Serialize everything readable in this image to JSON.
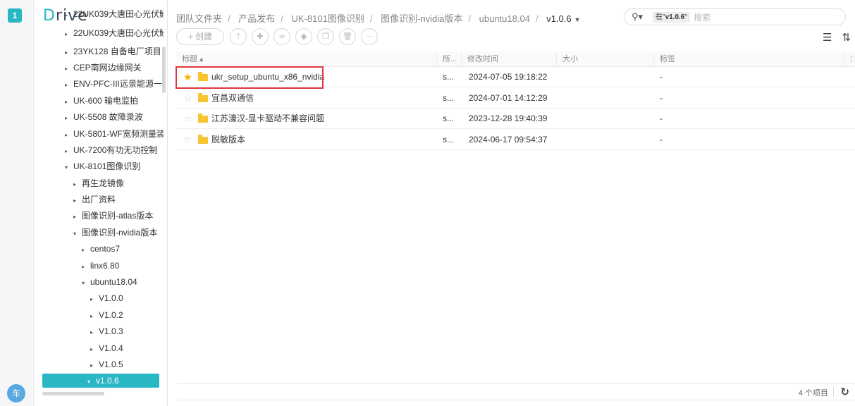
{
  "rail": {
    "workspace_badge": "1",
    "user_avatar": "车"
  },
  "app": {
    "logo_first": "D",
    "logo_rest": "rive"
  },
  "tree": [
    {
      "label": "22UK039大唐田心光伏鳗",
      "arrow": "▸"
    },
    {
      "label": "23YK128 自备电厂项目",
      "arrow": "▸"
    },
    {
      "label": "CEP南网边缘网关",
      "arrow": "▸"
    },
    {
      "label": "ENV-PFC-III远景能源一次",
      "arrow": "▸"
    },
    {
      "label": "UK-600 输电监拍",
      "arrow": "▸"
    },
    {
      "label": "UK-5508 故障录波",
      "arrow": "▸"
    },
    {
      "label": "UK-5801-WF宽频测量装",
      "arrow": "▸"
    },
    {
      "label": "UK-7200有功无功控制",
      "arrow": "▸"
    },
    {
      "label": "UK-8101图像识别",
      "arrow": "▾"
    },
    {
      "label": "再生龙镜像",
      "arrow": "▸"
    },
    {
      "label": "出厂资料",
      "arrow": "▸"
    },
    {
      "label": "图像识别-atlas版本",
      "arrow": "▸"
    },
    {
      "label": "图像识别-nvidia版本",
      "arrow": "▾"
    },
    {
      "label": "centos7",
      "arrow": "▸"
    },
    {
      "label": "linx6.80",
      "arrow": "▸"
    },
    {
      "label": "ubuntu18.04",
      "arrow": "▾"
    },
    {
      "label": "V1.0.0",
      "arrow": "▸"
    },
    {
      "label": "V1.0.2",
      "arrow": "▸"
    },
    {
      "label": "V1.0.3",
      "arrow": "▸"
    },
    {
      "label": "V1.0.4",
      "arrow": "▸"
    },
    {
      "label": "V1.0.5",
      "arrow": "▸"
    },
    {
      "label": "v1.0.6",
      "arrow": "▾"
    }
  ],
  "breadcrumb": {
    "items": [
      "团队文件夹",
      "产品发布",
      "UK-8101图像识别",
      "图像识别-nvidia版本",
      "ubuntu18.04"
    ],
    "current": "v1.0.6"
  },
  "search": {
    "scope_prefix": "在\"",
    "scope_name": "v1.0.6",
    "scope_suffix": "\"",
    "placeholder": "搜索"
  },
  "toolbar": {
    "create_label": "+ 创建"
  },
  "table": {
    "headers": {
      "title": "标题 ▴",
      "owner": "所...",
      "modified": "修改时间",
      "size": "大小",
      "tags": "标签"
    },
    "rows": [
      {
        "name": "ukr_setup_ubuntu_x86_nvidia",
        "owner": "s...",
        "modified": "2024-07-05 19:18:22",
        "size": "",
        "tags": "-",
        "starred": true
      },
      {
        "name": "宜昌双通信",
        "owner": "s...",
        "modified": "2024-07-01 14:12:29",
        "size": "",
        "tags": "-",
        "starred": false
      },
      {
        "name": "江苏濠汉-显卡驱动不兼容问题",
        "owner": "s...",
        "modified": "2023-12-28 19:40:39",
        "size": "",
        "tags": "-",
        "starred": false
      },
      {
        "name": "脱敏版本",
        "owner": "s...",
        "modified": "2024-06-17 09:54:37",
        "size": "",
        "tags": "-",
        "starred": false
      }
    ]
  },
  "footer": {
    "count": "4 个项目"
  },
  "colors": {
    "accent": "#2ab7c4",
    "star": "#f5b400",
    "folder": "#f8c430",
    "highlight": "#e0393e"
  }
}
